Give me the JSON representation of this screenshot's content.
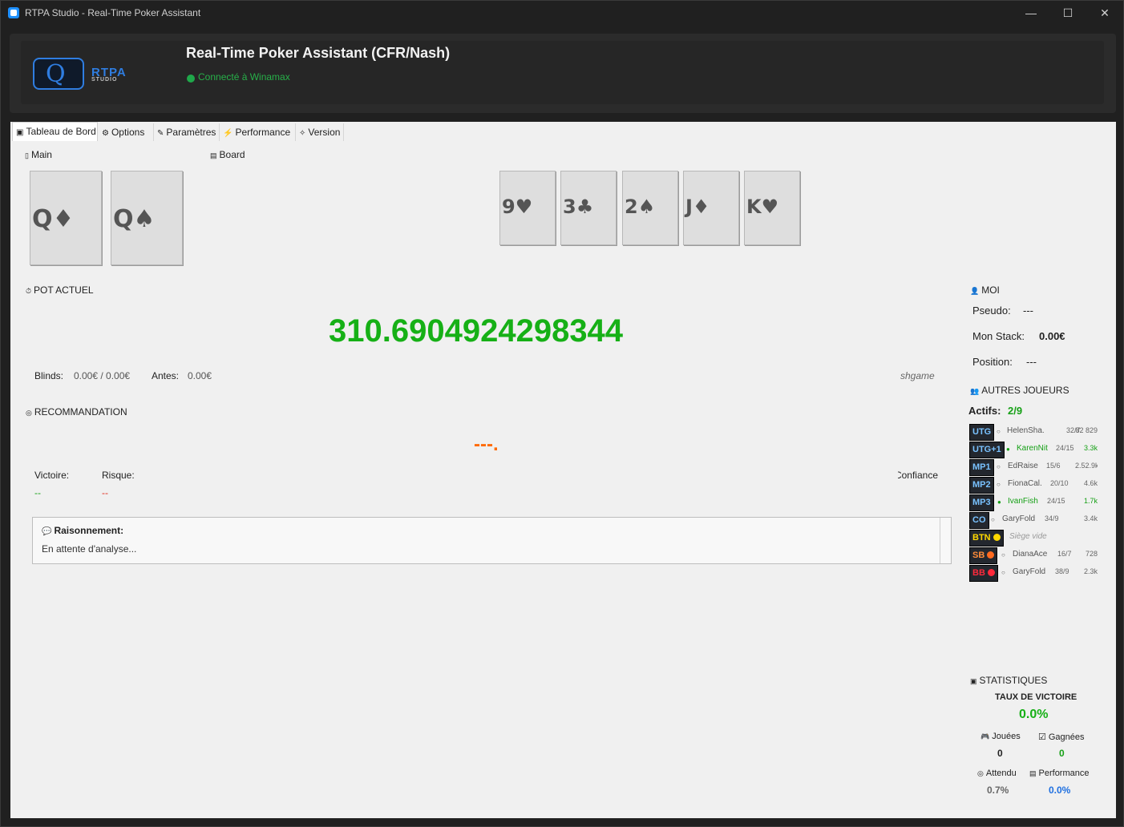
{
  "window": {
    "title": "RTPA Studio - Real-Time Poker Assistant",
    "controls": {
      "minimize": "—",
      "maximize": "☐",
      "close": "✕"
    }
  },
  "header": {
    "logo_text": "RTPA",
    "logo_sub": "STUDIO",
    "app_title": "Real-Time Poker Assistant (CFR/Nash)",
    "connection_status": "Connecté à Winamax",
    "connection_color": "#27b049"
  },
  "tabs": [
    {
      "label": "Tableau de Bord",
      "icon": "dashboard-icon"
    },
    {
      "label": "Options",
      "icon": "gear-icon"
    },
    {
      "label": "Paramètres",
      "icon": "wrench-icon"
    },
    {
      "label": "Performance",
      "icon": "lightning-icon"
    },
    {
      "label": "Version",
      "icon": "pin-icon"
    }
  ],
  "hand": {
    "label": "Main",
    "cards": [
      "Q♦",
      "Q♠"
    ]
  },
  "board": {
    "label": "Board",
    "cards": [
      "9♥",
      "3♣",
      "2♠",
      "J♦",
      "K♥"
    ]
  },
  "pot": {
    "label": "POT ACTUEL",
    "value": "310.6904924298344",
    "blinds_label": "Blinds:",
    "blinds_value": "0.00€ / 0.00€",
    "antes_label": "Antes:",
    "antes_value": "0.00€",
    "game_type": "shgame"
  },
  "recommendation": {
    "label": "RECOMMANDATION",
    "value": "---.",
    "victory_label": "Victoire:",
    "victory_value": "--",
    "risk_label": "Risque:",
    "risk_value": "--",
    "confidence_label": "Confiance:"
  },
  "reasoning": {
    "title": "Raisonnement:",
    "text": "En attente d'analyse..."
  },
  "me": {
    "label": "MOI",
    "pseudo_label": "Pseudo:",
    "pseudo_value": "---",
    "stack_label": "Mon Stack:",
    "stack_value": "0.00€",
    "position_label": "Position:",
    "position_value": "---"
  },
  "others": {
    "label": "AUTRES JOUEURS",
    "actifs_label": "Actifs:",
    "actifs_value": "2/9",
    "players": [
      {
        "pos": "UTG",
        "active": false,
        "name": "HelenSha.",
        "hud": "32/7",
        "stack": "82 829"
      },
      {
        "pos": "UTG+1",
        "active": true,
        "name": "KarenNit",
        "hud": "24/15",
        "stack": "3.3k"
      },
      {
        "pos": "MP1",
        "active": false,
        "name": "EdRaise",
        "hud": "15/6",
        "stack": "2.52.9k"
      },
      {
        "pos": "MP2",
        "active": false,
        "name": "FionaCal.",
        "hud": "20/10",
        "stack": "4.6k"
      },
      {
        "pos": "MP3",
        "active": true,
        "name": "IvanFish",
        "hud": "24/15",
        "stack": "1.7k"
      },
      {
        "pos": "CO",
        "active": false,
        "name": "GaryFold",
        "hud": "34/9",
        "stack": "3.4k"
      },
      {
        "pos": "BTN",
        "active": false,
        "name": "Siège vide",
        "hud": "",
        "stack": "",
        "empty": true
      },
      {
        "pos": "SB",
        "active": false,
        "name": "DianaAce",
        "hud": "16/7",
        "stack": "728"
      },
      {
        "pos": "BB",
        "active": false,
        "name": "GaryFold",
        "hud": "38/9",
        "stack": "2.3k"
      }
    ]
  },
  "stats": {
    "label": "STATISTIQUES",
    "win_rate_label": "TAUX DE VICTOIRE",
    "win_rate_value": "0.0%",
    "played_label": "Jouées",
    "played_value": "0",
    "won_label": "Gagnées",
    "won_value": "0",
    "expected_label": "Attendu",
    "expected_value": "0.7%",
    "performance_label": "Performance",
    "performance_value": "0.0%"
  },
  "colors": {
    "accent_green": "#16b016",
    "recommendation_orange": "#ff6a00",
    "brand_blue": "#2f7de0",
    "perf_blue": "#1e6fe0"
  }
}
